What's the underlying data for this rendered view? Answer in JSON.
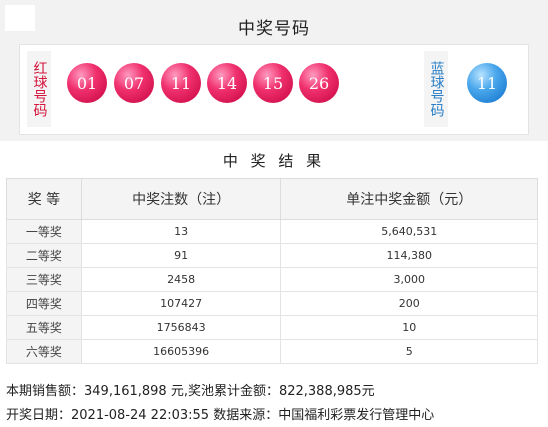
{
  "header": {
    "title": "中奖号码"
  },
  "red_label": "红球号码",
  "blue_label": "蓝球号码",
  "red_balls": [
    "01",
    "07",
    "11",
    "14",
    "15",
    "26"
  ],
  "blue_ball": "11",
  "result_title": "中 奖 结 果",
  "table": {
    "headers": [
      "奖 等",
      "中奖注数（注）",
      "单注中奖金额（元）"
    ],
    "rows": [
      {
        "level": "一等奖",
        "count": "13",
        "amount": "5,640,531"
      },
      {
        "level": "二等奖",
        "count": "91",
        "amount": "114,380"
      },
      {
        "level": "三等奖",
        "count": "2458",
        "amount": "3,000"
      },
      {
        "level": "四等奖",
        "count": "107427",
        "amount": "200"
      },
      {
        "level": "五等奖",
        "count": "1756843",
        "amount": "10"
      },
      {
        "level": "六等奖",
        "count": "16605396",
        "amount": "5"
      }
    ]
  },
  "footer": {
    "line1": "本期销售额：349,161,898 元,奖池累计金额：822,388,985元",
    "line2": "开奖日期：2021-08-24 22:03:55 数据来源：中国福利彩票发行管理中心"
  },
  "colors": {
    "red_ball": "#e02760",
    "blue_ball": "#3593e0",
    "red_text": "#d4143b",
    "blue_text": "#2a7fc8",
    "panel_bg": "#f2f2f2"
  }
}
